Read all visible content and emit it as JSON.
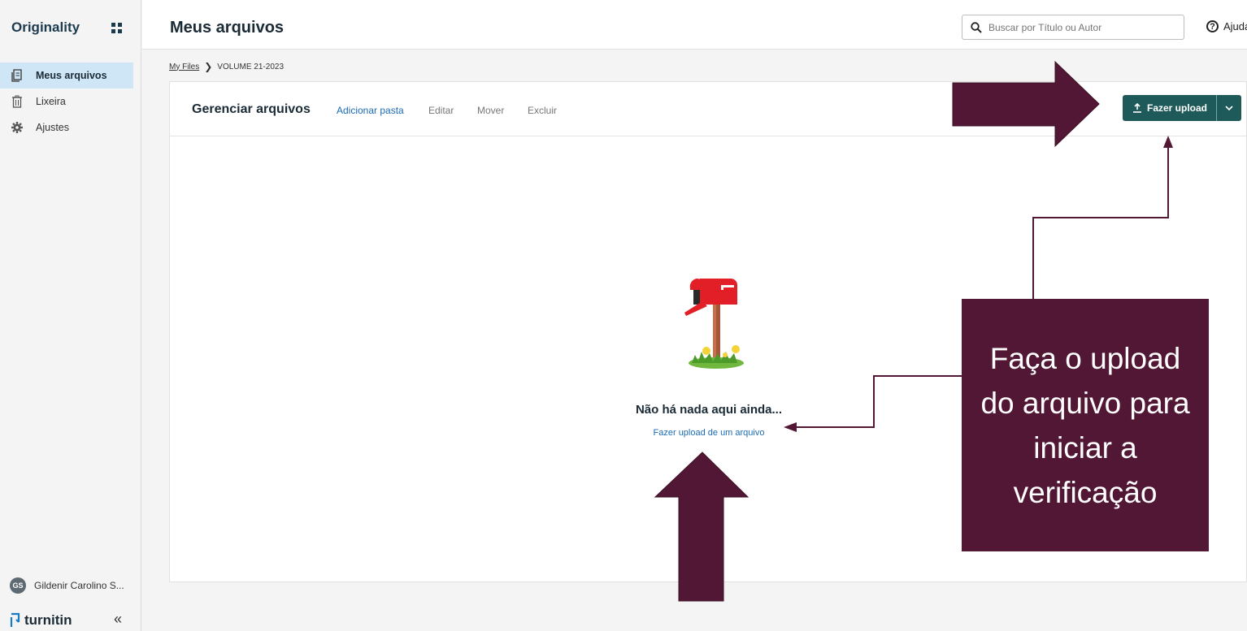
{
  "app": {
    "brand": "Originality",
    "product_logo": "turnitin"
  },
  "sidebar": {
    "items": [
      {
        "label": "Meus arquivos",
        "icon": "files-icon",
        "active": true
      },
      {
        "label": "Lixeira",
        "icon": "trash-icon",
        "active": false
      },
      {
        "label": "Ajustes",
        "icon": "gear-icon",
        "active": false
      }
    ],
    "user": {
      "initials": "GS",
      "name": "Gildenir Carolino S..."
    },
    "collapse_glyph": "«"
  },
  "header": {
    "title": "Meus arquivos",
    "search": {
      "placeholder": "Buscar por Título ou Autor",
      "value": ""
    },
    "help_label": "Ajuda"
  },
  "breadcrumb": {
    "root": "My Files",
    "current": "VOLUME 21-2023"
  },
  "toolbar": {
    "title": "Gerenciar arquivos",
    "add_folder": "Adicionar pasta",
    "edit": "Editar",
    "move": "Mover",
    "delete": "Excluir",
    "upload": "Fazer upload"
  },
  "empty_state": {
    "title": "Não há nada aqui ainda...",
    "link": "Fazer upload de um arquivo"
  },
  "annotation": {
    "text": "Faça o upload do arquivo para iniciar a verificação",
    "color": "#521734"
  },
  "colors": {
    "accent": "#1f5a5a",
    "link": "#1a6bb5",
    "active_nav": "#cfe6f6"
  }
}
